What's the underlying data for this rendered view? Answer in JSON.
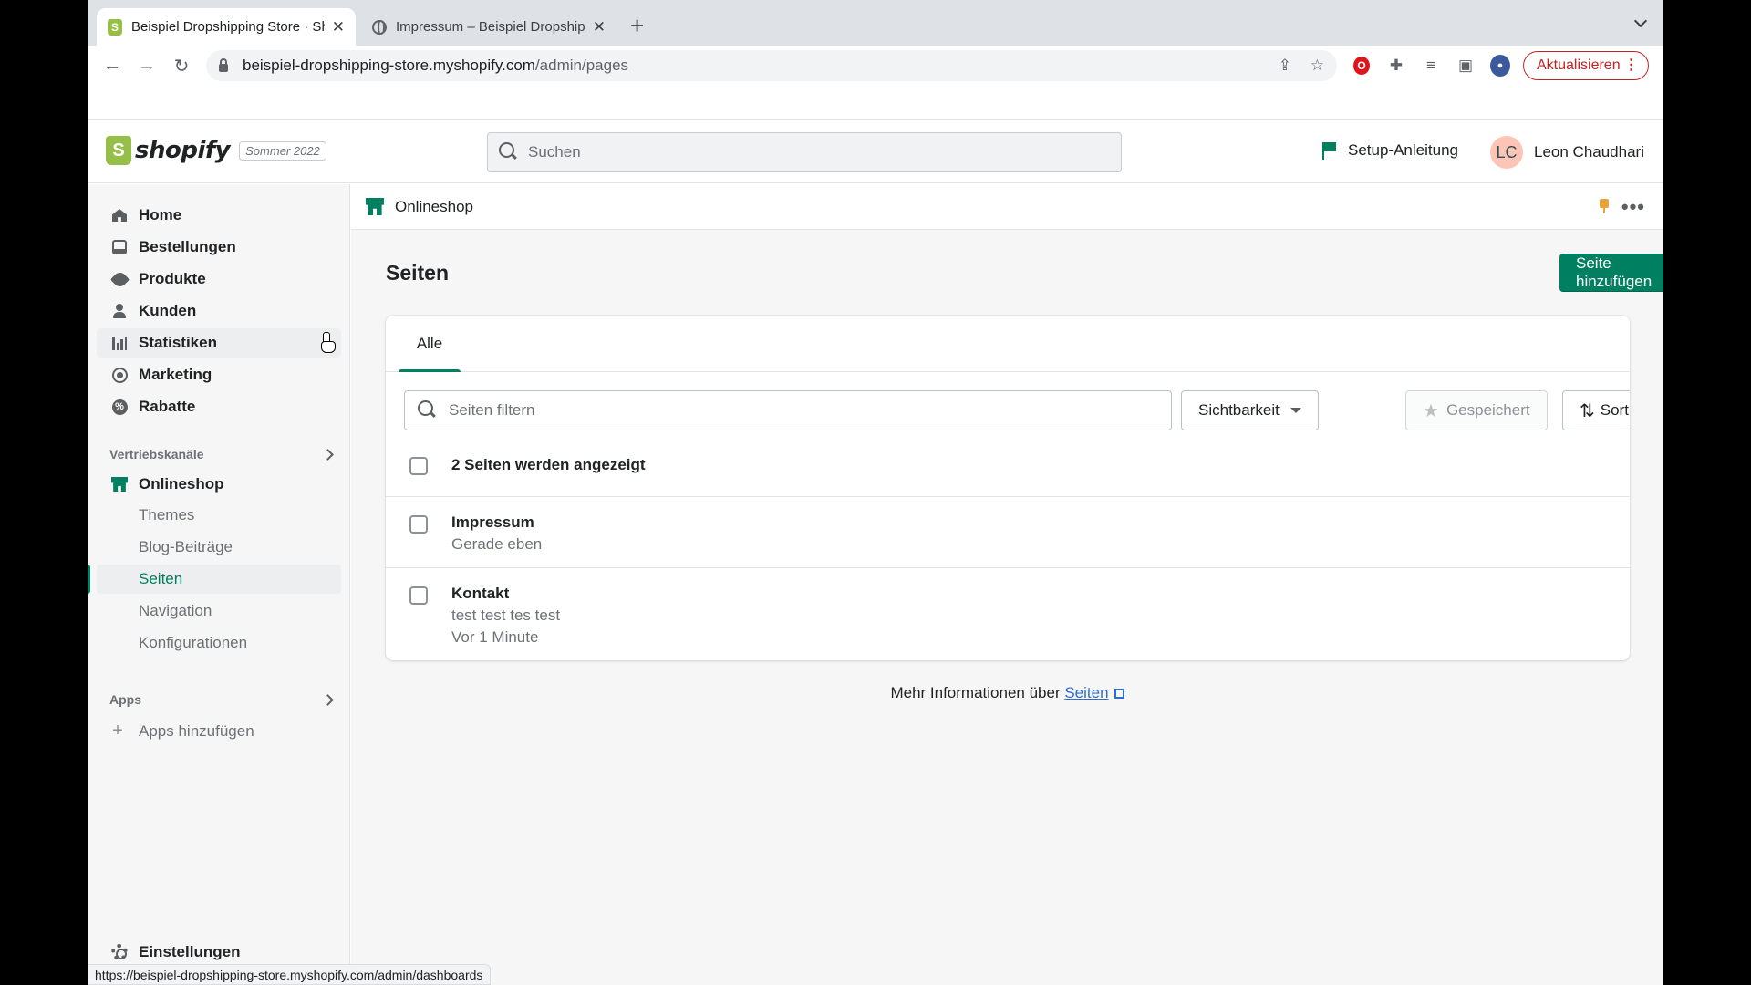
{
  "browser": {
    "tabs": [
      {
        "title": "Beispiel Dropshipping Store · Sh",
        "favicon": "shopify-bag-icon"
      },
      {
        "title": "Impressum – Beispiel Dropshipping",
        "favicon": "globe-icon"
      }
    ],
    "url_host": "beispiel-dropshipping-store.myshopify.com",
    "url_path": "/admin/pages",
    "update_label": "Aktualisieren",
    "status_url": "https://beispiel-dropshipping-store.myshopify.com/admin/dashboards"
  },
  "topbar": {
    "logo_text": "shopify",
    "logo_letter": "S",
    "edition": "Sommer 2022",
    "search_placeholder": "Suchen",
    "setup_label": "Setup-Anleitung",
    "user_initials": "LC",
    "user_name": "Leon Chaudhari"
  },
  "sidebar": {
    "items": [
      {
        "label": "Home",
        "icon": "home-icon"
      },
      {
        "label": "Bestellungen",
        "icon": "orders-icon"
      },
      {
        "label": "Produkte",
        "icon": "tag-icon"
      },
      {
        "label": "Kunden",
        "icon": "customer-icon"
      },
      {
        "label": "Statistiken",
        "icon": "analytics-icon"
      },
      {
        "label": "Marketing",
        "icon": "marketing-icon"
      },
      {
        "label": "Rabatte",
        "icon": "discount-icon"
      }
    ],
    "sales_channels_heading": "Vertriebskanäle",
    "online_store": "Onlineshop",
    "sub_items": [
      "Themes",
      "Blog-Beiträge",
      "Seiten",
      "Navigation",
      "Konfigurationen"
    ],
    "apps_heading": "Apps",
    "add_apps": "Apps hinzufügen",
    "settings": "Einstellungen"
  },
  "main": {
    "channel": "Onlineshop",
    "title": "Seiten",
    "add_button": "Seite hinzufügen",
    "tab_all": "Alle",
    "filter_placeholder": "Seiten filtern",
    "visibility": "Sichtbarkeit",
    "saved": "Gespeichert",
    "sort": "Sortieren",
    "count_text": "2 Seiten werden angezeigt",
    "rows": [
      {
        "name": "Impressum",
        "lines": [
          "Gerade eben"
        ]
      },
      {
        "name": "Kontakt",
        "lines": [
          "test test tes test",
          "Vor 1 Minute"
        ]
      }
    ],
    "more_info_prefix": "Mehr Informationen über",
    "more_info_link": "Seiten"
  },
  "colors": {
    "primary": "#008060",
    "shopify_green": "#95bf47",
    "link": "#2c6ecb",
    "update_red": "#c5221f"
  }
}
